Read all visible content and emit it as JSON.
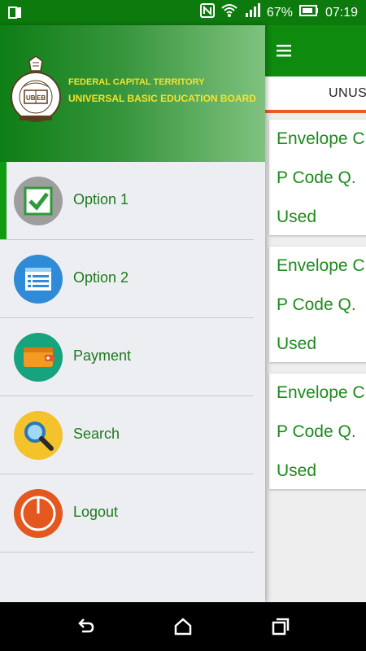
{
  "status_bar": {
    "battery_percent": "67%",
    "time": "07:19",
    "icons": [
      "sim-card-icon",
      "nfc-icon",
      "wifi-icon",
      "signal-icon",
      "battery-icon"
    ]
  },
  "header": {
    "line1": "FEDERAL CAPITAL TERRITORY",
    "line2": "UNIVERSAL BASIC EDUCATION BOARD",
    "logo_text": "UBEB",
    "logo_ring_text": "UNIVERSAL BASIC EDUCATION BOARD"
  },
  "menu": {
    "items": [
      {
        "label": "Option 1",
        "icon": "checkbox-icon",
        "active": true
      },
      {
        "label": "Option 2",
        "icon": "list-icon",
        "active": false
      },
      {
        "label": "Payment",
        "icon": "wallet-icon",
        "active": false
      },
      {
        "label": "Search",
        "icon": "magnifier-icon",
        "active": false
      },
      {
        "label": "Logout",
        "icon": "power-icon",
        "active": false
      }
    ]
  },
  "background_app": {
    "tab_label": "UNUS",
    "cards": [
      {
        "title": "Envelope C",
        "code": "P Code Q.",
        "status": "Used"
      },
      {
        "title": "Envelope C",
        "code": "P Code Q.",
        "status": "Used"
      },
      {
        "title": "Envelope C",
        "code": "P Code Q.",
        "status": "Used"
      }
    ]
  },
  "colors": {
    "primary": "#0e8a0e",
    "accent": "#f05a22",
    "header_text": "#f5e32a",
    "menu_text": "#1d7a1d"
  },
  "nav_bar": {
    "icons": [
      "back-icon",
      "home-icon",
      "recents-icon"
    ]
  }
}
